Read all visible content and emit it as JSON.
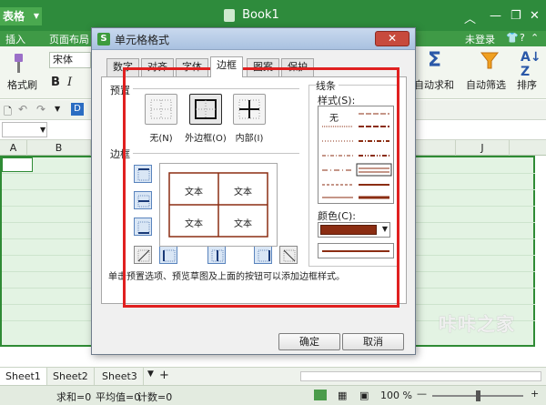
{
  "app": {
    "menu_label": "表格",
    "doc_tab": "Book1",
    "login": "未登录"
  },
  "menubar": [
    "插入",
    "页面布局"
  ],
  "ribbon": {
    "font_name": "宋体",
    "format_painter": "格式刷",
    "bold": "B",
    "italic": "I",
    "autosum": "自动求和",
    "autofilter": "自动筛选",
    "sort": "排序",
    "sort_icon_text": "A\nZ"
  },
  "columns": [
    "A",
    "B",
    "J"
  ],
  "sheets": [
    "Sheet1",
    "Sheet2",
    "Sheet3"
  ],
  "status": {
    "sum": "求和=0",
    "avg": "平均值=0",
    "count": "计数=0",
    "zoom": "100 %"
  },
  "dialog": {
    "title": "单元格格式",
    "tabs": [
      "数字",
      "对齐",
      "字体",
      "边框",
      "图案",
      "保护"
    ],
    "active_tab": "边框",
    "preset_label": "预置",
    "presets": [
      "无(N)",
      "外边框(O)",
      "内部(I)"
    ],
    "border_label": "边框",
    "preview_cells": [
      "文本",
      "文本",
      "文本",
      "文本"
    ],
    "line_section": "线条",
    "style_label": "样式(S):",
    "style_none": "无",
    "color_label": "颜色(C):",
    "line_color": "#8b2d12",
    "hint": "单击预置选项、预览草图及上面的按钮可以添加边框样式。",
    "ok": "确定",
    "cancel": "取消"
  },
  "watermark": "咔咔之家"
}
